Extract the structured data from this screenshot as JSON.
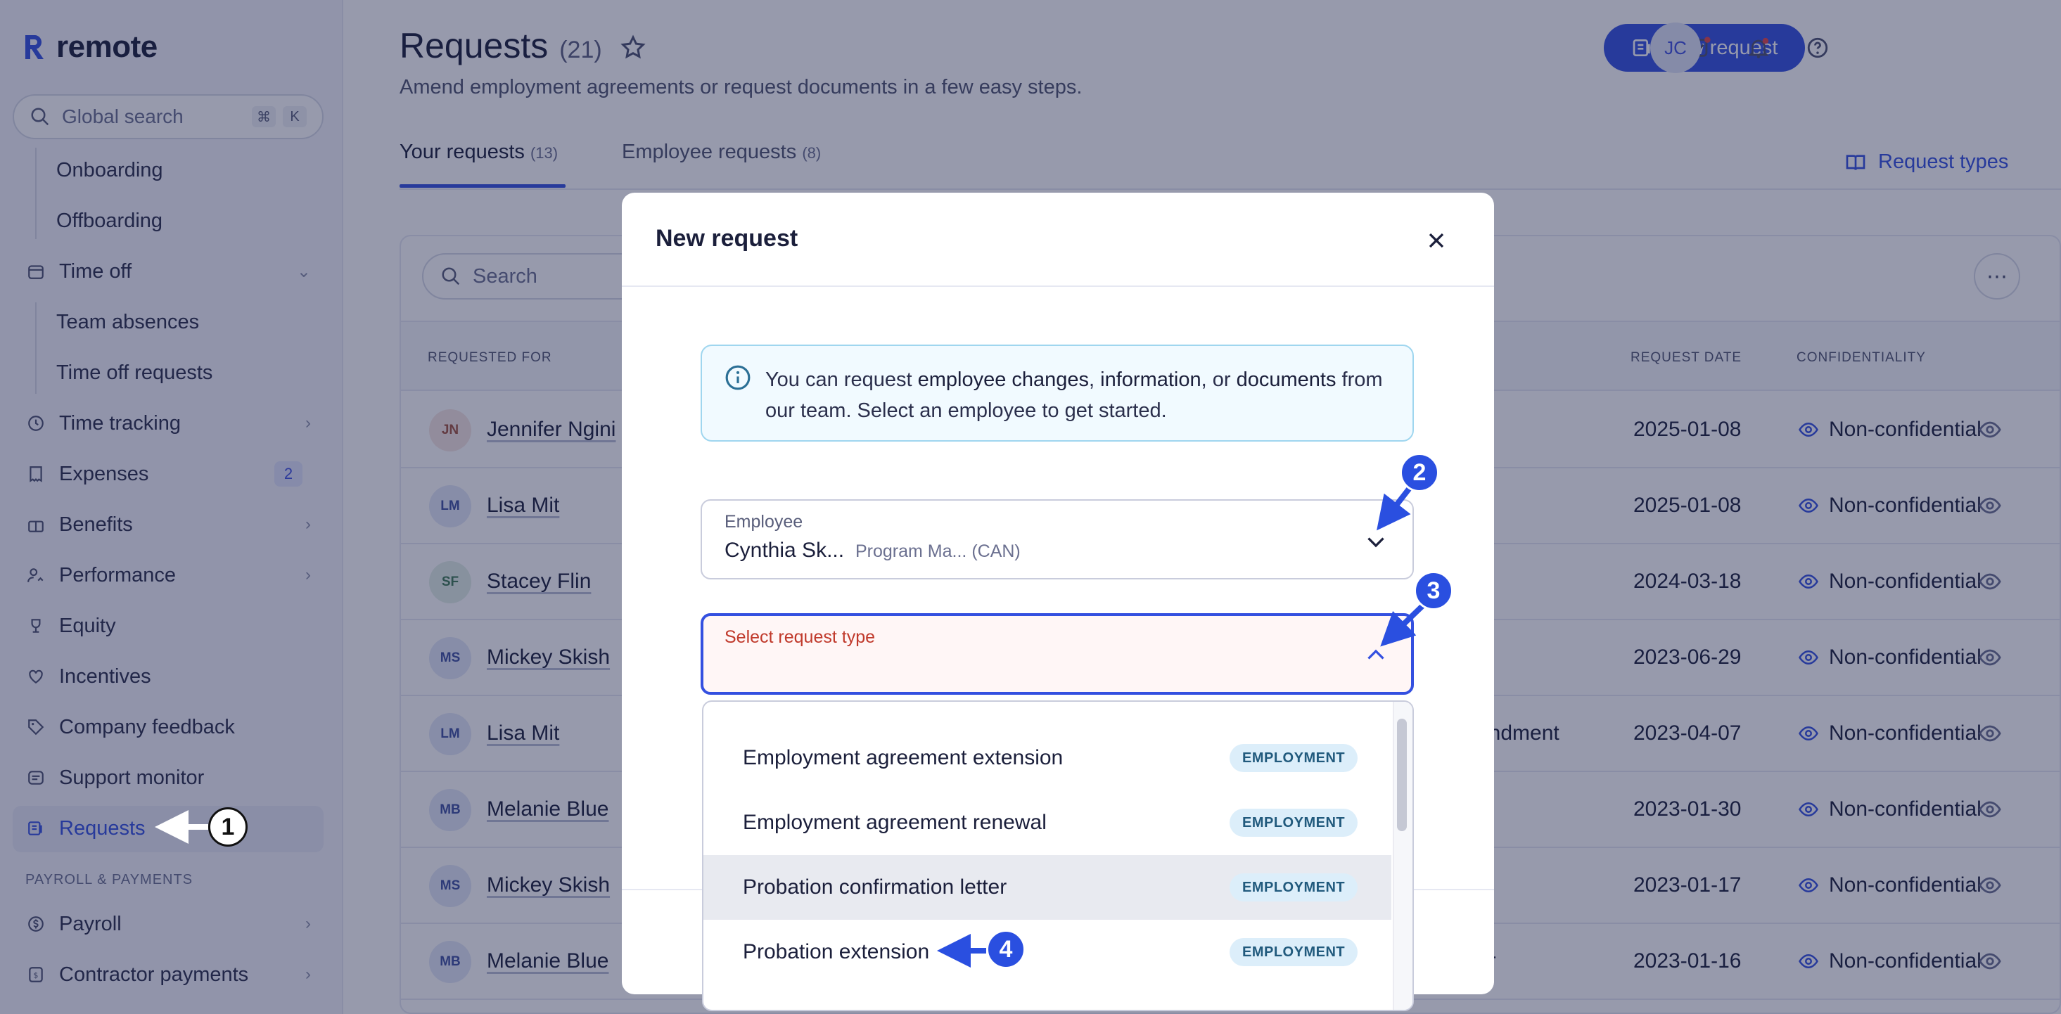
{
  "app": {
    "logo_text": "remote"
  },
  "sidebar": {
    "search_placeholder": "Global search",
    "kbd": [
      "⌘",
      "K"
    ],
    "items": [
      {
        "label": "Onboarding",
        "type": "sub"
      },
      {
        "label": "Offboarding",
        "type": "sub"
      },
      {
        "label": "Time off",
        "icon": "calendar-icon",
        "chevron": "down"
      },
      {
        "label": "Team absences",
        "type": "sub"
      },
      {
        "label": "Time off requests",
        "type": "sub"
      },
      {
        "label": "Time tracking",
        "icon": "clock-icon",
        "chevron": "right"
      },
      {
        "label": "Expenses",
        "icon": "receipt-icon",
        "badge": "2"
      },
      {
        "label": "Benefits",
        "icon": "gift-icon",
        "chevron": "right"
      },
      {
        "label": "Performance",
        "icon": "user-growth-icon",
        "chevron": "right"
      },
      {
        "label": "Equity",
        "icon": "trophy-icon"
      },
      {
        "label": "Incentives",
        "icon": "heart-icon"
      },
      {
        "label": "Company feedback",
        "icon": "tag-icon"
      },
      {
        "label": "Support monitor",
        "icon": "support-icon"
      },
      {
        "label": "Requests",
        "icon": "requests-icon",
        "active": true
      },
      {
        "label": "Payroll",
        "icon": "dollar-icon",
        "chevron": "right"
      },
      {
        "label": "Contractor payments",
        "icon": "invoice-icon",
        "chevron": "right"
      }
    ],
    "section_label": "PAYROLL & PAYMENTS"
  },
  "header": {
    "title": "Requests",
    "count": "(21)",
    "subtitle": "Amend employment agreements or request documents in a few easy steps.",
    "new_request_label": "New request",
    "avatar_initials": "JC"
  },
  "tabs": [
    {
      "label": "Your requests",
      "count": "(13)",
      "active": true
    },
    {
      "label": "Employee requests",
      "count": "(8)",
      "active": false
    }
  ],
  "request_types_label": "Request types",
  "table": {
    "search_placeholder": "Search",
    "headers": {
      "requested_for": "REQUESTED FOR",
      "request_date": "REQUEST DATE",
      "confidentiality": "CONFIDENTIALITY"
    },
    "rows": [
      {
        "initials": "JN",
        "name": "Jennifer Ngini",
        "type": "",
        "date": "2025-01-08",
        "conf": "Non-confidential",
        "avatar_bg": "#f6e6e2",
        "avatar_fg": "#a0533f"
      },
      {
        "initials": "LM",
        "name": "Lisa Mit",
        "type": "",
        "date": "2025-01-08",
        "conf": "Non-confidential",
        "avatar_bg": "#e2e7f7",
        "avatar_fg": "#3e51a0"
      },
      {
        "initials": "SF",
        "name": "Stacey Flin",
        "type": "",
        "date": "2024-03-18",
        "conf": "Non-confidential",
        "avatar_bg": "#e2efe6",
        "avatar_fg": "#3f7a55"
      },
      {
        "initials": "MS",
        "name": "Mickey Skish",
        "type": "",
        "date": "2023-06-29",
        "conf": "Non-confidential",
        "avatar_bg": "#e2e7f7",
        "avatar_fg": "#3e51a0"
      },
      {
        "initials": "LM",
        "name": "Lisa Mit",
        "type": "endment",
        "date": "2023-04-07",
        "conf": "Non-confidential",
        "avatar_bg": "#e2e7f7",
        "avatar_fg": "#3e51a0"
      },
      {
        "initials": "MB",
        "name": "Melanie Blue",
        "type": "",
        "date": "2023-01-30",
        "conf": "Non-confidential",
        "avatar_bg": "#e2e7f7",
        "avatar_fg": "#3e51a0"
      },
      {
        "initials": "MS",
        "name": "Mickey Skish",
        "type": "",
        "date": "2023-01-17",
        "conf": "Non-confidential",
        "avatar_bg": "#e2e7f7",
        "avatar_fg": "#3e51a0"
      },
      {
        "initials": "MB",
        "name": "Melanie Blue",
        "type": "er",
        "date": "2023-01-16",
        "conf": "Non-confidential",
        "avatar_bg": "#e2e7f7",
        "avatar_fg": "#3e51a0"
      }
    ]
  },
  "modal": {
    "title": "New request",
    "info_prefix": "You can request ",
    "info_b1": "employee changes",
    "info_sep1": ", ",
    "info_b2": "information",
    "info_sep2": ", or ",
    "info_b3": "documents",
    "info_suffix": " from our team. Select an employee to get started.",
    "employee_label": "Employee",
    "employee_name": "Cynthia Sk...",
    "employee_meta": "Program Ma... (CAN)",
    "request_type_label": "Select request type",
    "options": [
      {
        "label": "Employment agreement extension",
        "tag": "EMPLOYMENT",
        "highlighted": false
      },
      {
        "label": "Employment agreement renewal",
        "tag": "EMPLOYMENT",
        "highlighted": false
      },
      {
        "label": "Probation confirmation letter",
        "tag": "EMPLOYMENT",
        "highlighted": true
      },
      {
        "label": "Probation extension",
        "tag": "EMPLOYMENT",
        "highlighted": false
      }
    ]
  },
  "annotations": [
    "1",
    "2",
    "3",
    "4"
  ],
  "colors": {
    "accent": "#3450e0",
    "overlay": "#191e46",
    "annotation": "#2a4fe0"
  }
}
